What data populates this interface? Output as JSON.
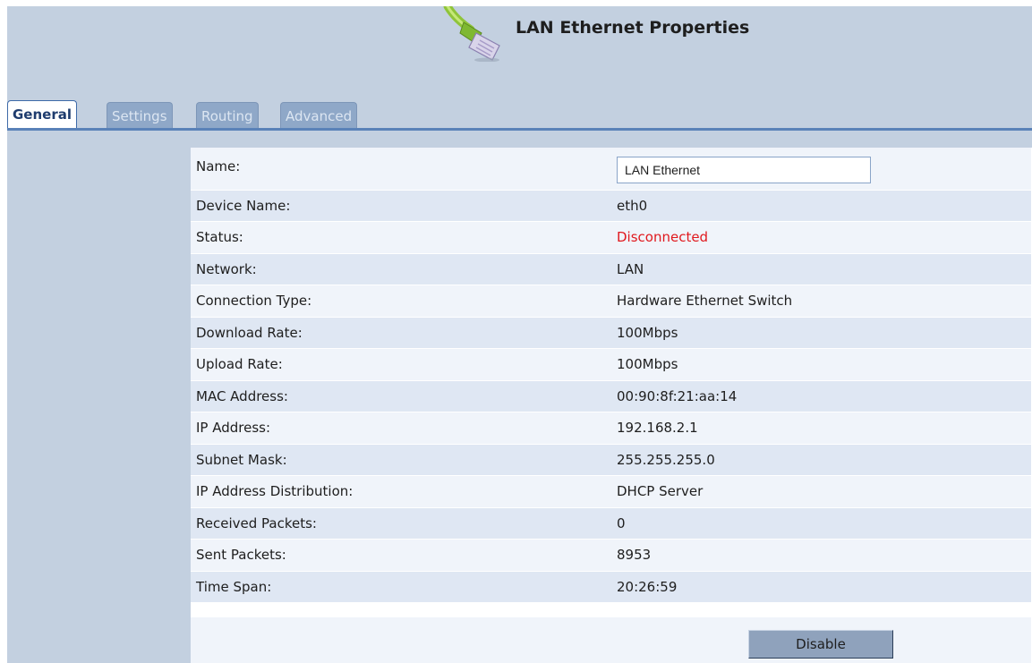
{
  "header": {
    "title": "LAN Ethernet Properties",
    "icon": "ethernet-cable-icon"
  },
  "tabs": [
    {
      "label": "General",
      "active": true
    },
    {
      "label": "Settings",
      "active": false
    },
    {
      "label": "Routing",
      "active": false
    },
    {
      "label": "Advanced",
      "active": false
    }
  ],
  "properties": {
    "name": {
      "label": "Name:",
      "value": "LAN Ethernet"
    },
    "rows": [
      {
        "label": "Device Name:",
        "value": "eth0"
      },
      {
        "label": "Status:",
        "value": "Disconnected"
      },
      {
        "label": "Network:",
        "value": "LAN"
      },
      {
        "label": "Connection Type:",
        "value": "Hardware Ethernet Switch"
      },
      {
        "label": "Download Rate:",
        "value": "100Mbps"
      },
      {
        "label": "Upload Rate:",
        "value": "100Mbps"
      },
      {
        "label": "MAC Address:",
        "value": "00:90:8f:21:aa:14"
      },
      {
        "label": "IP Address:",
        "value": "192.168.2.1"
      },
      {
        "label": "Subnet Mask:",
        "value": "255.255.255.0"
      },
      {
        "label": "IP Address Distribution:",
        "value": "DHCP Server"
      },
      {
        "label": "Received Packets:",
        "value": "0"
      },
      {
        "label": "Sent Packets:",
        "value": "8953"
      },
      {
        "label": "Time Span:",
        "value": "20:26:59"
      }
    ]
  },
  "actions": {
    "disable_label": "Disable"
  },
  "colors": {
    "panel_blue": "#c3d0e0",
    "status_disconnected": "#e0191e",
    "tab_accent": "#5a82b8"
  }
}
